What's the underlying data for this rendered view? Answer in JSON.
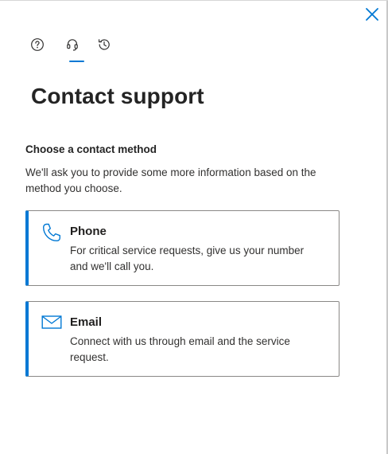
{
  "close": {
    "icon": "close-icon",
    "color": "#0078d4"
  },
  "tabs": [
    {
      "icon": "help-icon",
      "active": false
    },
    {
      "icon": "headset-icon",
      "active": true
    },
    {
      "icon": "history-icon",
      "active": false
    }
  ],
  "title": "Contact support",
  "method": {
    "heading": "Choose a contact method",
    "description": "We'll ask you to provide some more information based on the method you choose."
  },
  "options": {
    "phone": {
      "icon": "phone-icon",
      "title": "Phone",
      "description": "For critical service requests, give us your number and we'll call you."
    },
    "email": {
      "icon": "mail-icon",
      "title": "Email",
      "description": "Connect with us through email and the service request."
    }
  },
  "colors": {
    "accent": "#0078d4",
    "text": "#201f1e"
  }
}
